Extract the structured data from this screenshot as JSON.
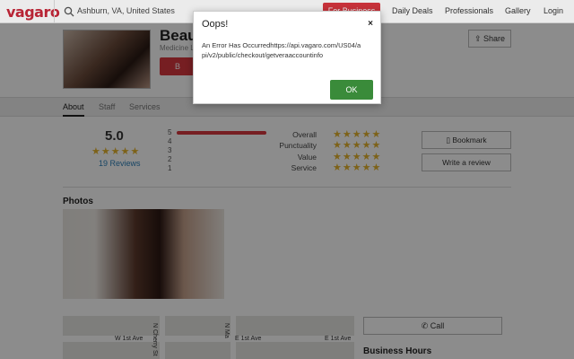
{
  "header": {
    "logo": "vagaro",
    "search_value": "Ashburn, VA, United States",
    "for_business": "For Business",
    "nav": [
      "Daily Deals",
      "Professionals",
      "Gallery",
      "Login"
    ]
  },
  "business": {
    "name": "Beau",
    "subtitle": "Medicine L",
    "book_label": "B",
    "share_label": "Share"
  },
  "tabs": [
    "About",
    "Staff",
    "Services"
  ],
  "ratings": {
    "score": "5.0",
    "reviews": "19 Reviews",
    "bars": [
      "5",
      "4",
      "3",
      "2",
      "1"
    ],
    "five_star_fraction": 1.0,
    "categories": [
      "Overall",
      "Punctuality",
      "Value",
      "Service"
    ],
    "stars": "★★★★★"
  },
  "actions": {
    "bookmark": "Bookmark",
    "write_review": "Write a review"
  },
  "photos_title": "Photos",
  "map": {
    "streets": [
      "W 1st Ave",
      "E 1st Ave",
      "E 1st Ave",
      "N Cherry St",
      "N Ma"
    ]
  },
  "call_label": "Call",
  "hours_title": "Business Hours",
  "modal": {
    "title": "Oops!",
    "close": "×",
    "message": "An Error Has Occurredhttps://api.vagaro.com/US04/api/v2/public/checkout/getveraaccountinfo",
    "ok": "OK"
  },
  "colors": {
    "brand_red": "#d8373f",
    "ok_green": "#3a8b3a",
    "star_gold": "#e4b32d",
    "link_blue": "#2c7fb8"
  }
}
